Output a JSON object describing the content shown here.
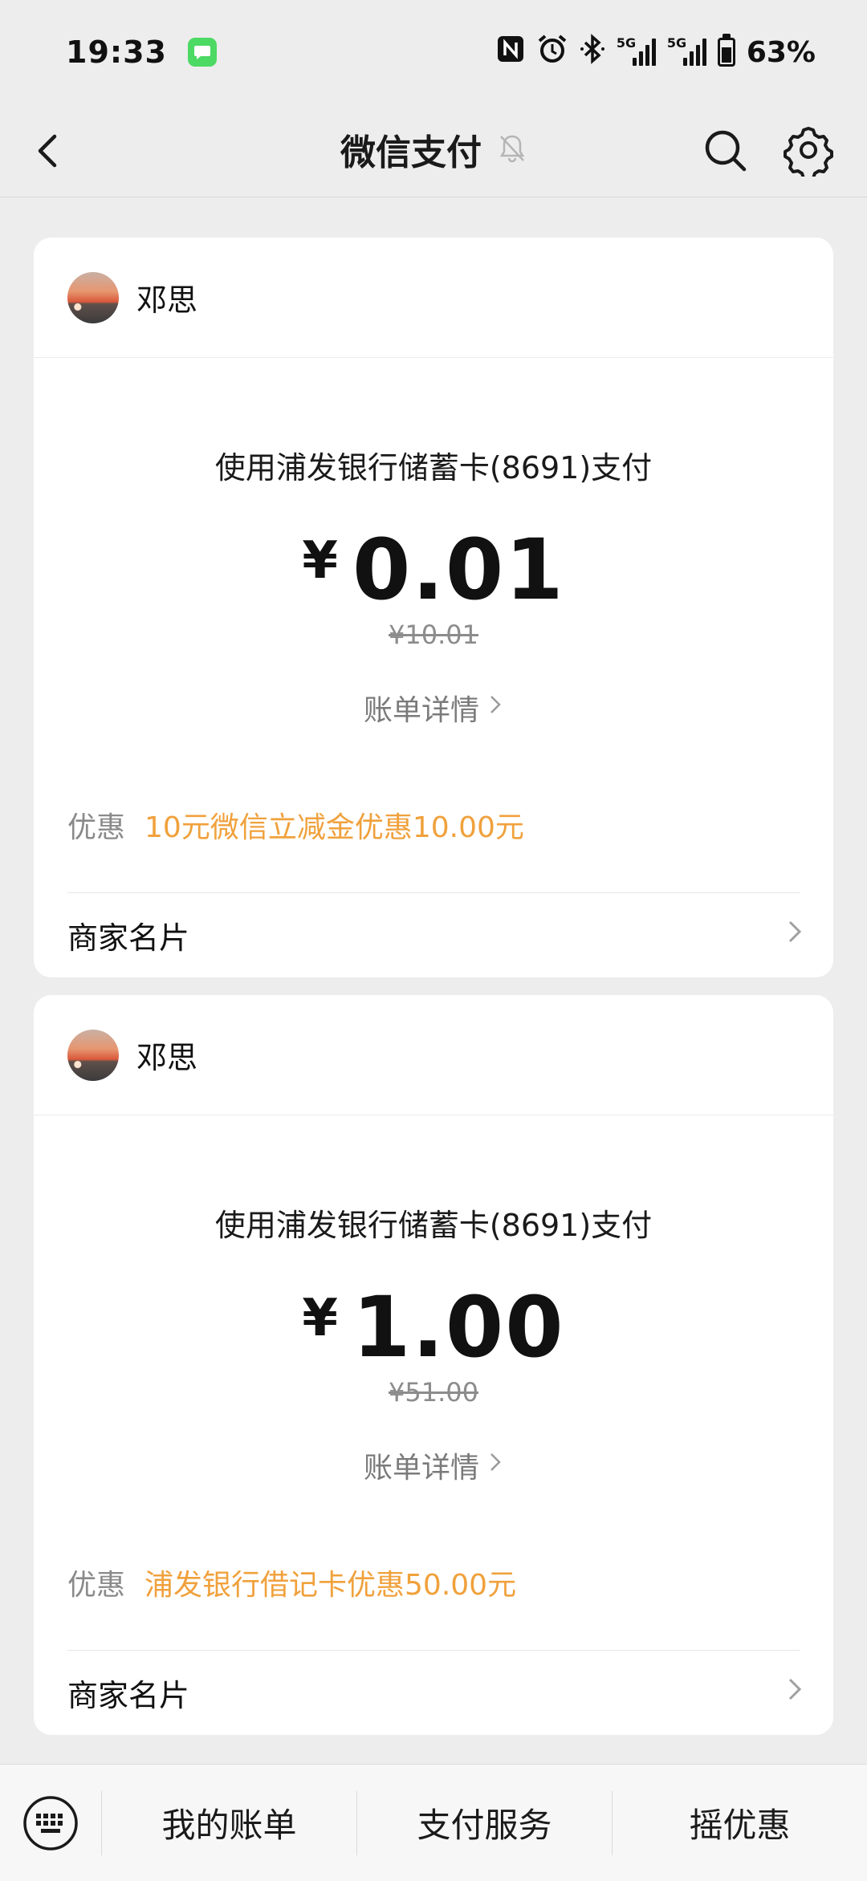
{
  "status_bar": {
    "time": "19:33",
    "net1": "5G",
    "net2": "5G",
    "battery": "63%",
    "battery_level": 0.63,
    "icons": [
      "messages-app-icon",
      "nfc-icon",
      "alarm-icon",
      "bluetooth-icon",
      "signal-icon",
      "battery-icon"
    ]
  },
  "nav": {
    "title": "微信支付",
    "icons": [
      "back-icon",
      "mute-bell-icon",
      "search-icon",
      "gear-icon"
    ]
  },
  "payments": [
    {
      "merchant": "邓思",
      "method": "使用浦发银行储蓄卡(8691)支付",
      "currency": "¥",
      "amount": "0.01",
      "original": "¥10.01",
      "detail_link": "账单详情",
      "discount_label": "优惠",
      "discount_text": "10元微信立减金优惠10.00元",
      "merchant_card": "商家名片"
    },
    {
      "merchant": "邓思",
      "method": "使用浦发银行储蓄卡(8691)支付",
      "currency": "¥",
      "amount": "1.00",
      "original": "¥51.00",
      "detail_link": "账单详情",
      "discount_label": "优惠",
      "discount_text": "浦发银行借记卡优惠50.00元",
      "merchant_card": "商家名片"
    }
  ],
  "tab_bar": {
    "tabs": [
      "我的账单",
      "支付服务",
      "摇优惠"
    ],
    "icons": [
      "keyboard-icon"
    ]
  },
  "colors": {
    "background": "#ededed",
    "card": "#ffffff",
    "discount": "#f0a13c",
    "muted": "#8a8a8a"
  }
}
